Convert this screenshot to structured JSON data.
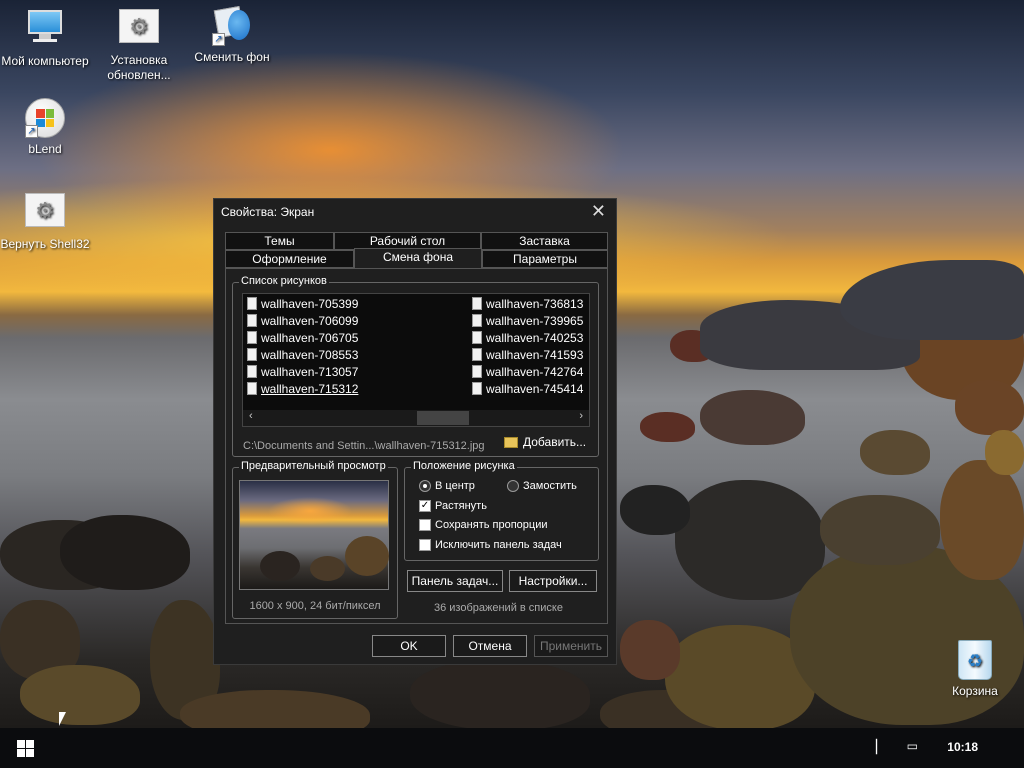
{
  "desktop": {
    "icons": [
      {
        "label": "Мой компьютер"
      },
      {
        "label": "Установка обновлен..."
      },
      {
        "label": "Сменить фон"
      },
      {
        "label": "bLend"
      },
      {
        "label": "Вернуть Shell32"
      },
      {
        "label": "Корзина"
      }
    ]
  },
  "dialog": {
    "title": "Свойства: Экран",
    "close_glyph": "✕",
    "tabs_row1": [
      "Темы",
      "Рабочий стол",
      "Заставка"
    ],
    "tabs_row2": [
      "Оформление",
      "Смена фона",
      "Параметры"
    ],
    "active_tab": "Смена фона",
    "list_group_label": "Список рисунков",
    "files_col1": [
      "wallhaven-705399",
      "wallhaven-706099",
      "wallhaven-706705",
      "wallhaven-708553",
      "wallhaven-713057",
      "wallhaven-715312"
    ],
    "files_col2": [
      "wallhaven-736813",
      "wallhaven-739965",
      "wallhaven-740253",
      "wallhaven-741593",
      "wallhaven-742764",
      "wallhaven-745414"
    ],
    "selected_file": "wallhaven-715312",
    "scroll_left": "‹",
    "scroll_right": "›",
    "path": "C:\\Documents and Settin...\\wallhaven-715312.jpg",
    "add_button": "Добавить...",
    "preview_label": "Предварительный просмотр",
    "preview_info": "1600 x 900, 24 бит/пиксел",
    "position_label": "Положение рисунка",
    "opt_center": "В центр",
    "opt_tile": "Замостить",
    "opt_stretch": "Растянуть",
    "opt_keep": "Сохранять пропорции",
    "opt_exclude": "Исключить панель задач",
    "taskbar_button": "Панель задач...",
    "settings_button": "Настройки...",
    "count_text": "36 изображений в списке",
    "ok": "OK",
    "cancel": "Отмена",
    "apply": "Применить"
  },
  "taskbar": {
    "clock": "10:18"
  }
}
